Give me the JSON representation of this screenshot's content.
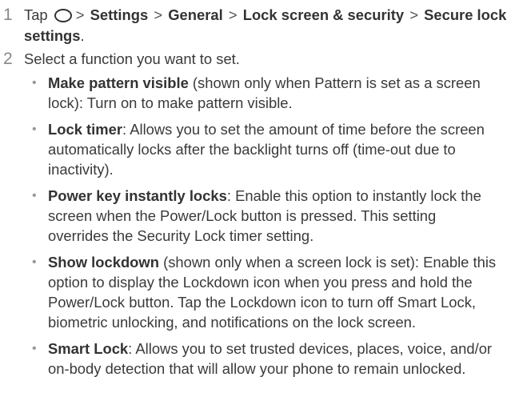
{
  "step1": {
    "number": "1",
    "text_before_icon": "Tap",
    "icon": "home-button-icon",
    "path": [
      "Settings",
      "General",
      "Lock screen & security",
      "Secure lock settings"
    ],
    "separator": ">",
    "end_punctuation": "."
  },
  "step2": {
    "number": "2",
    "text": "Select a function you want to set."
  },
  "bullets": [
    {
      "term": "Make pattern visible",
      "rest": " (shown only when Pattern is set as a screen lock): Turn on to make pattern visible."
    },
    {
      "term": "Lock timer",
      "rest": ": Allows you to set the amount of time before the screen automatically locks after the backlight turns off (time-out due to inactivity)."
    },
    {
      "term": "Power key instantly locks",
      "rest": ": Enable this option to instantly lock the screen when the Power/Lock button is pressed. This setting overrides the Security Lock timer setting."
    },
    {
      "term": "Show lockdown",
      "rest": " (shown only when a screen lock is set): Enable this option to display the Lockdown icon when you press and hold the Power/Lock button. Tap the Lockdown icon to turn off Smart Lock, biometric unlocking, and notifications on the lock screen."
    },
    {
      "term": "Smart Lock",
      "rest": ": Allows you to set trusted devices, places, voice, and/or on-body detection that will allow your phone to remain unlocked."
    }
  ]
}
